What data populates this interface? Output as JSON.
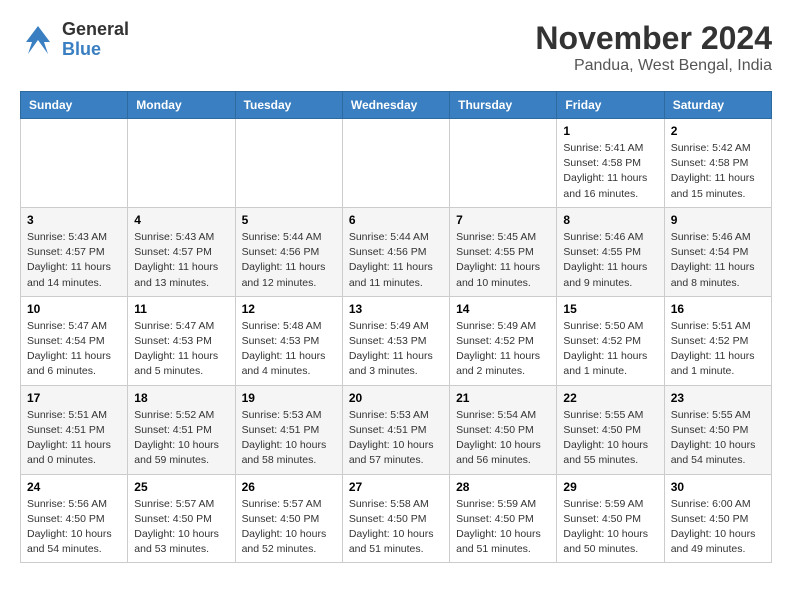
{
  "header": {
    "logo_line1": "General",
    "logo_line2": "Blue",
    "month": "November 2024",
    "location": "Pandua, West Bengal, India"
  },
  "days_of_week": [
    "Sunday",
    "Monday",
    "Tuesday",
    "Wednesday",
    "Thursday",
    "Friday",
    "Saturday"
  ],
  "weeks": [
    [
      {
        "day": "",
        "detail": ""
      },
      {
        "day": "",
        "detail": ""
      },
      {
        "day": "",
        "detail": ""
      },
      {
        "day": "",
        "detail": ""
      },
      {
        "day": "",
        "detail": ""
      },
      {
        "day": "1",
        "detail": "Sunrise: 5:41 AM\nSunset: 4:58 PM\nDaylight: 11 hours and 16 minutes."
      },
      {
        "day": "2",
        "detail": "Sunrise: 5:42 AM\nSunset: 4:58 PM\nDaylight: 11 hours and 15 minutes."
      }
    ],
    [
      {
        "day": "3",
        "detail": "Sunrise: 5:43 AM\nSunset: 4:57 PM\nDaylight: 11 hours and 14 minutes."
      },
      {
        "day": "4",
        "detail": "Sunrise: 5:43 AM\nSunset: 4:57 PM\nDaylight: 11 hours and 13 minutes."
      },
      {
        "day": "5",
        "detail": "Sunrise: 5:44 AM\nSunset: 4:56 PM\nDaylight: 11 hours and 12 minutes."
      },
      {
        "day": "6",
        "detail": "Sunrise: 5:44 AM\nSunset: 4:56 PM\nDaylight: 11 hours and 11 minutes."
      },
      {
        "day": "7",
        "detail": "Sunrise: 5:45 AM\nSunset: 4:55 PM\nDaylight: 11 hours and 10 minutes."
      },
      {
        "day": "8",
        "detail": "Sunrise: 5:46 AM\nSunset: 4:55 PM\nDaylight: 11 hours and 9 minutes."
      },
      {
        "day": "9",
        "detail": "Sunrise: 5:46 AM\nSunset: 4:54 PM\nDaylight: 11 hours and 8 minutes."
      }
    ],
    [
      {
        "day": "10",
        "detail": "Sunrise: 5:47 AM\nSunset: 4:54 PM\nDaylight: 11 hours and 6 minutes."
      },
      {
        "day": "11",
        "detail": "Sunrise: 5:47 AM\nSunset: 4:53 PM\nDaylight: 11 hours and 5 minutes."
      },
      {
        "day": "12",
        "detail": "Sunrise: 5:48 AM\nSunset: 4:53 PM\nDaylight: 11 hours and 4 minutes."
      },
      {
        "day": "13",
        "detail": "Sunrise: 5:49 AM\nSunset: 4:53 PM\nDaylight: 11 hours and 3 minutes."
      },
      {
        "day": "14",
        "detail": "Sunrise: 5:49 AM\nSunset: 4:52 PM\nDaylight: 11 hours and 2 minutes."
      },
      {
        "day": "15",
        "detail": "Sunrise: 5:50 AM\nSunset: 4:52 PM\nDaylight: 11 hours and 1 minute."
      },
      {
        "day": "16",
        "detail": "Sunrise: 5:51 AM\nSunset: 4:52 PM\nDaylight: 11 hours and 1 minute."
      }
    ],
    [
      {
        "day": "17",
        "detail": "Sunrise: 5:51 AM\nSunset: 4:51 PM\nDaylight: 11 hours and 0 minutes."
      },
      {
        "day": "18",
        "detail": "Sunrise: 5:52 AM\nSunset: 4:51 PM\nDaylight: 10 hours and 59 minutes."
      },
      {
        "day": "19",
        "detail": "Sunrise: 5:53 AM\nSunset: 4:51 PM\nDaylight: 10 hours and 58 minutes."
      },
      {
        "day": "20",
        "detail": "Sunrise: 5:53 AM\nSunset: 4:51 PM\nDaylight: 10 hours and 57 minutes."
      },
      {
        "day": "21",
        "detail": "Sunrise: 5:54 AM\nSunset: 4:50 PM\nDaylight: 10 hours and 56 minutes."
      },
      {
        "day": "22",
        "detail": "Sunrise: 5:55 AM\nSunset: 4:50 PM\nDaylight: 10 hours and 55 minutes."
      },
      {
        "day": "23",
        "detail": "Sunrise: 5:55 AM\nSunset: 4:50 PM\nDaylight: 10 hours and 54 minutes."
      }
    ],
    [
      {
        "day": "24",
        "detail": "Sunrise: 5:56 AM\nSunset: 4:50 PM\nDaylight: 10 hours and 54 minutes."
      },
      {
        "day": "25",
        "detail": "Sunrise: 5:57 AM\nSunset: 4:50 PM\nDaylight: 10 hours and 53 minutes."
      },
      {
        "day": "26",
        "detail": "Sunrise: 5:57 AM\nSunset: 4:50 PM\nDaylight: 10 hours and 52 minutes."
      },
      {
        "day": "27",
        "detail": "Sunrise: 5:58 AM\nSunset: 4:50 PM\nDaylight: 10 hours and 51 minutes."
      },
      {
        "day": "28",
        "detail": "Sunrise: 5:59 AM\nSunset: 4:50 PM\nDaylight: 10 hours and 51 minutes."
      },
      {
        "day": "29",
        "detail": "Sunrise: 5:59 AM\nSunset: 4:50 PM\nDaylight: 10 hours and 50 minutes."
      },
      {
        "day": "30",
        "detail": "Sunrise: 6:00 AM\nSunset: 4:50 PM\nDaylight: 10 hours and 49 minutes."
      }
    ]
  ]
}
